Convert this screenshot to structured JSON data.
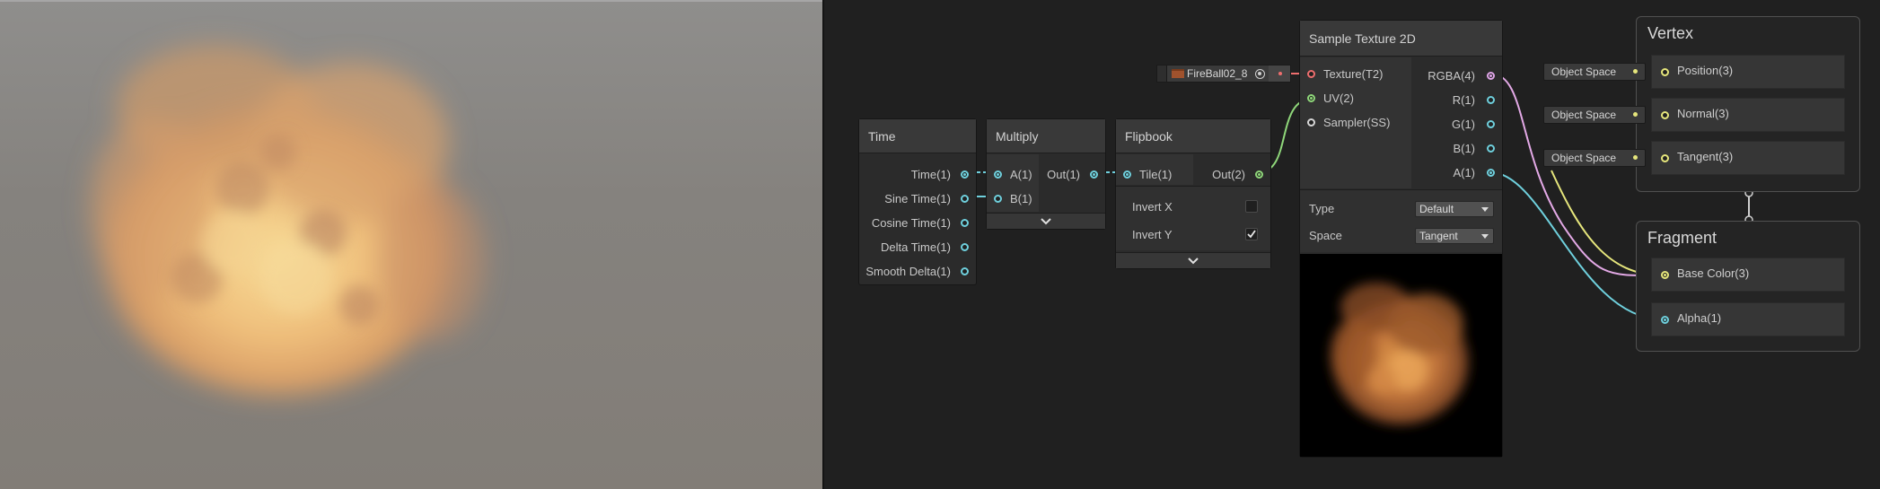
{
  "colors": {
    "cyan": "#6fd0dd",
    "green": "#8fd77a",
    "pink": "#f08e9a",
    "magenta": "#e0a6e8",
    "yellow": "#e6e67c",
    "node_bg": "#2b2b2b",
    "graph_bg": "#202020"
  },
  "time_node": {
    "title": "Time",
    "outputs": [
      "Time(1)",
      "Sine Time(1)",
      "Cosine Time(1)",
      "Delta Time(1)",
      "Smooth Delta(1)"
    ]
  },
  "multiply_node": {
    "title": "Multiply",
    "inputs": [
      "A(1)",
      "B(1)"
    ],
    "output": "Out(1)",
    "expand_icon": "chevron-down-icon"
  },
  "flipbook_node": {
    "title": "Flipbook",
    "input": "Tile(1)",
    "output": "Out(2)",
    "invert_x_label": "Invert X",
    "invert_x_checked": false,
    "invert_y_label": "Invert Y",
    "invert_y_checked": true,
    "expand_icon": "chevron-down-icon"
  },
  "texture_field": {
    "value": "FireBall02_8",
    "icons": [
      "texture-swatch-icon",
      "object-picker-icon"
    ]
  },
  "sample_texture": {
    "title": "Sample Texture 2D",
    "inputs": [
      "Texture(T2)",
      "UV(2)",
      "Sampler(SS)"
    ],
    "outputs": [
      "RGBA(4)",
      "R(1)",
      "G(1)",
      "B(1)",
      "A(1)"
    ],
    "type_label": "Type",
    "type_value": "Default",
    "space_label": "Space",
    "space_value": "Tangent"
  },
  "vertex": {
    "title": "Vertex",
    "slots": [
      "Position(3)",
      "Normal(3)",
      "Tangent(3)"
    ],
    "space_pills": [
      "Object Space",
      "Object Space",
      "Object Space"
    ]
  },
  "fragment": {
    "title": "Fragment",
    "slots": [
      "Base Color(3)",
      "Alpha(1)"
    ]
  }
}
